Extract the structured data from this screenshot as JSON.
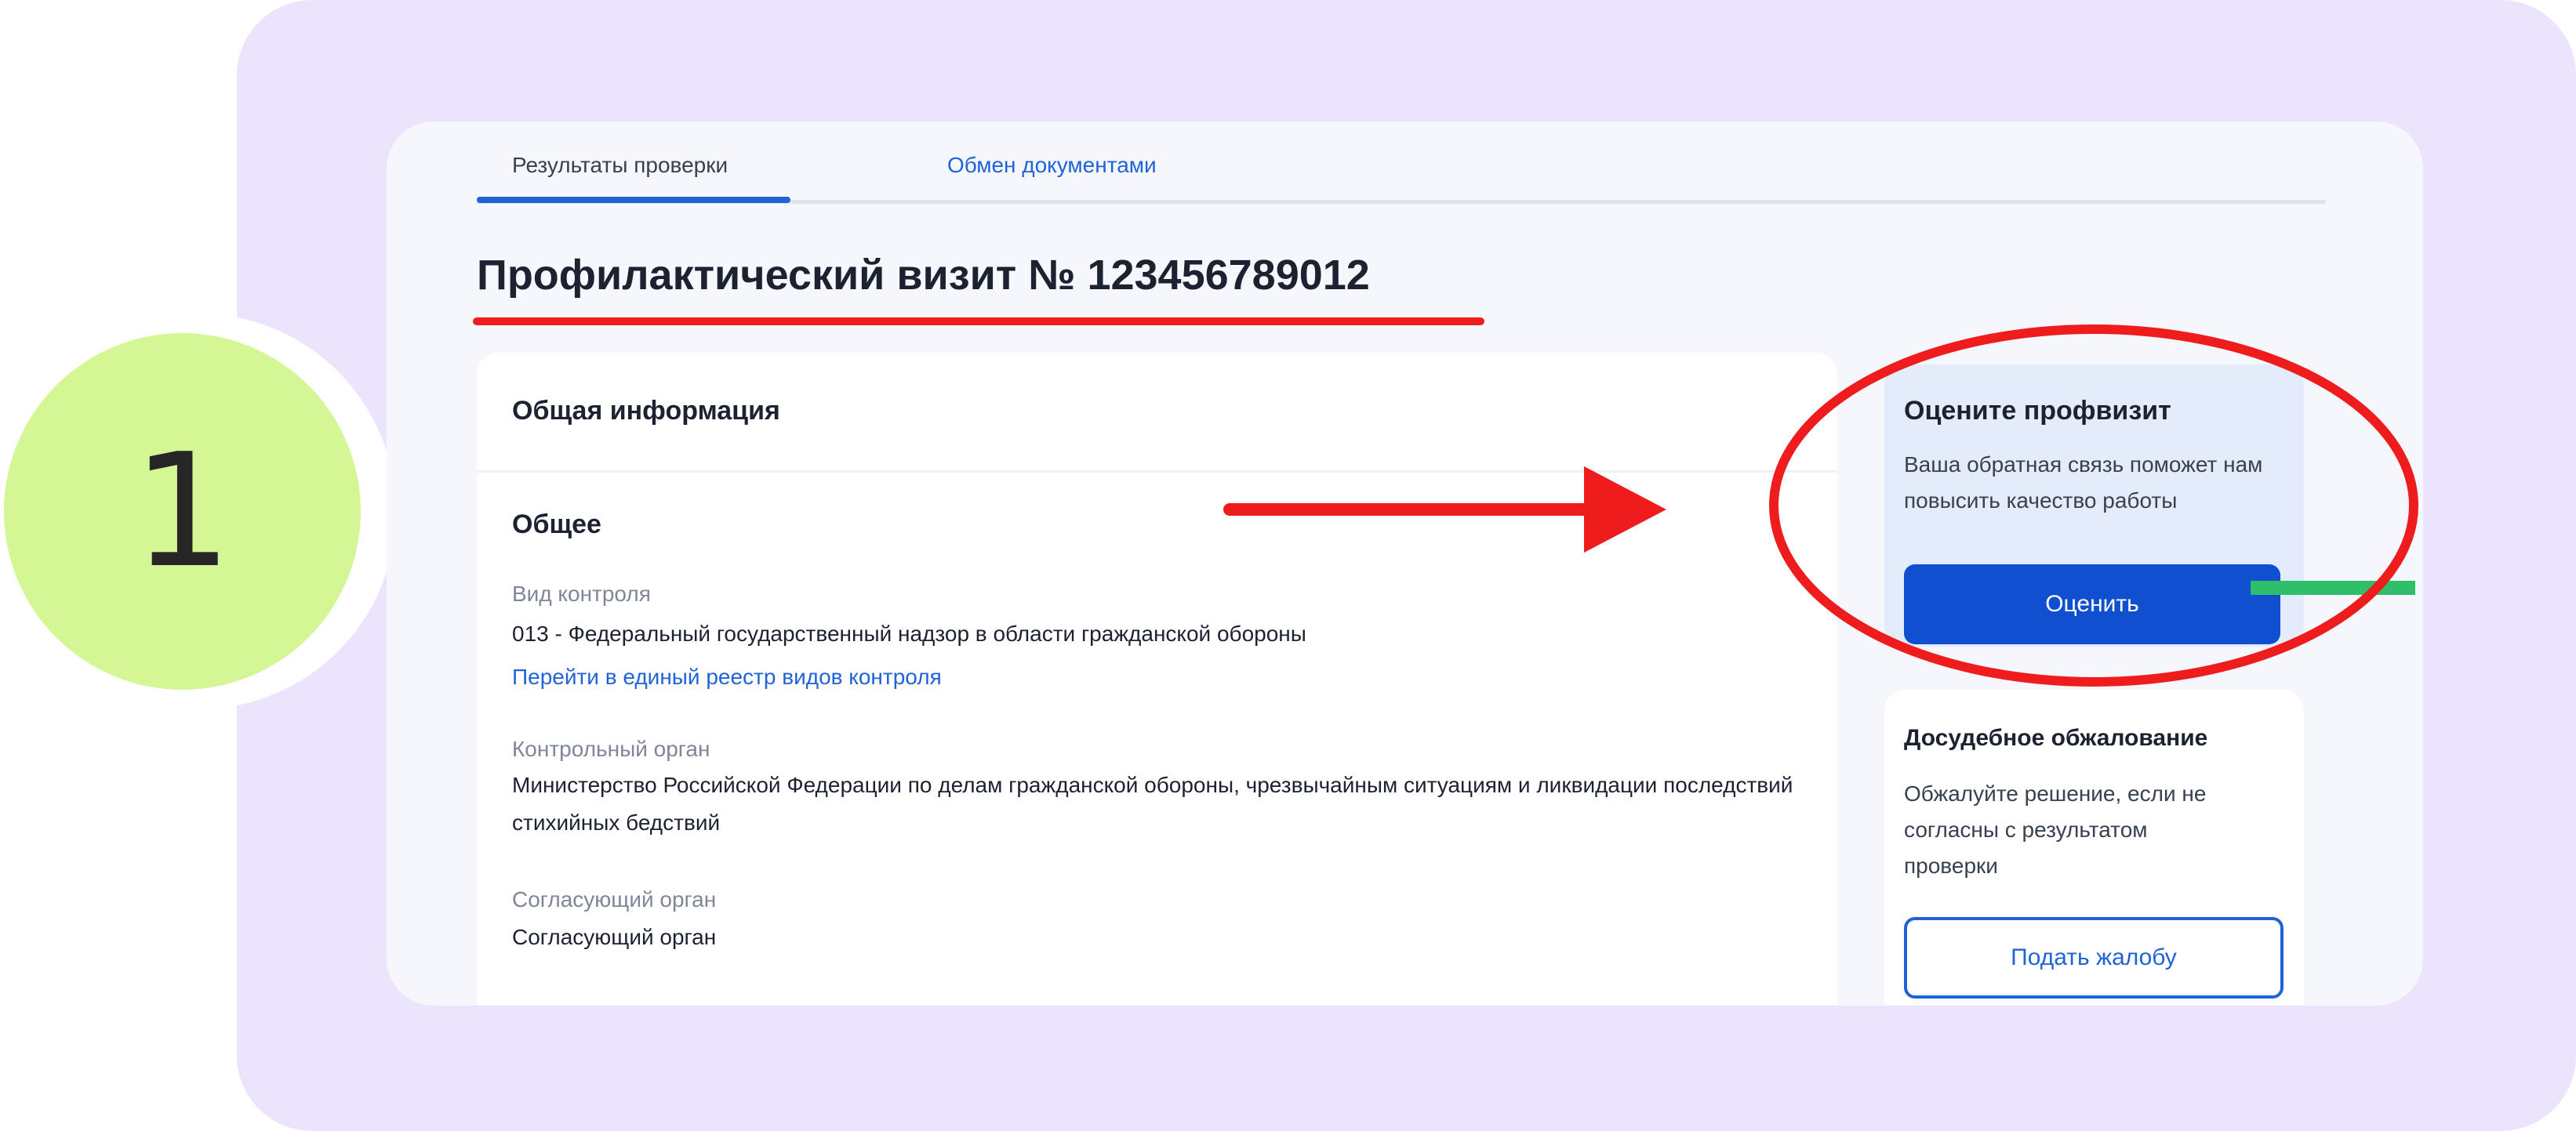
{
  "step": {
    "number": "1"
  },
  "tabs": [
    {
      "label": "Результаты проверки",
      "active": true
    },
    {
      "label": "Обмен документами",
      "active": false
    }
  ],
  "page_title": "Профилактический визит № 123456789012",
  "info_card": {
    "header": "Общая информация",
    "section_title": "Общее",
    "fields": {
      "control_type": {
        "label": "Вид контроля",
        "value": "013 - Федеральный государственный надзор в области гражданской обороны",
        "link": "Перейти в единый реестр видов контроля"
      },
      "control_body": {
        "label": "Контрольный орган",
        "value": "Министерство Российской Федерации по делам гражданской обороны, чрезвычайным ситуациям и ликвидации последствий стихийных бедствий"
      },
      "approving_body": {
        "label": "Согласующий орган",
        "value": "Согласующий орган"
      }
    }
  },
  "rate_card": {
    "title": "Оцените профвизит",
    "description": "Ваша обратная связь поможет нам повысить качество работы",
    "button_label": "Оценить"
  },
  "appeal_card": {
    "title": "Досудебное обжалование",
    "description": "Обжалуйте решение, если не согласны с результатом проверки",
    "button_label": "Подать жалобу"
  },
  "colors": {
    "accent": "#1f63d6",
    "primary_button": "#0f4fd0",
    "annotation_red": "#ee1c1c",
    "annotation_green": "#2fbf6a",
    "background_purple": "#ece4fd",
    "step_badge": "#d4f694"
  }
}
